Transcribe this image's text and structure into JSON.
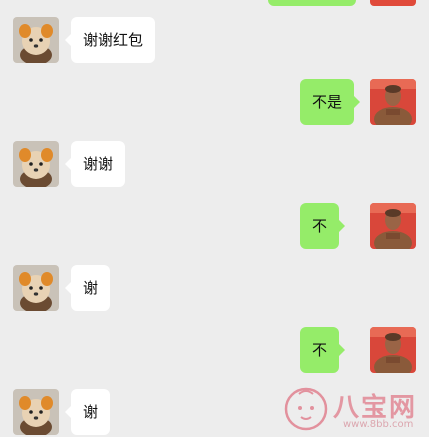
{
  "colors": {
    "background": "#ededed",
    "bubble_left": "#ffffff",
    "bubble_right": "#95ec69",
    "watermark": "#e07b8a"
  },
  "messages": [
    {
      "side": "left",
      "text": "谢谢红包",
      "avatar": "dog-avatar"
    },
    {
      "side": "right",
      "text": "不是",
      "avatar": "man-avatar"
    },
    {
      "side": "left",
      "text": "谢谢",
      "avatar": "dog-avatar"
    },
    {
      "side": "right",
      "text": "不",
      "avatar": "man-avatar"
    },
    {
      "side": "left",
      "text": "谢",
      "avatar": "dog-avatar"
    },
    {
      "side": "right",
      "text": "不",
      "avatar": "man-avatar"
    },
    {
      "side": "left",
      "text": "谢",
      "avatar": "dog-avatar"
    }
  ],
  "watermark": {
    "name": "八宝网",
    "url": "www.8bb.com"
  }
}
